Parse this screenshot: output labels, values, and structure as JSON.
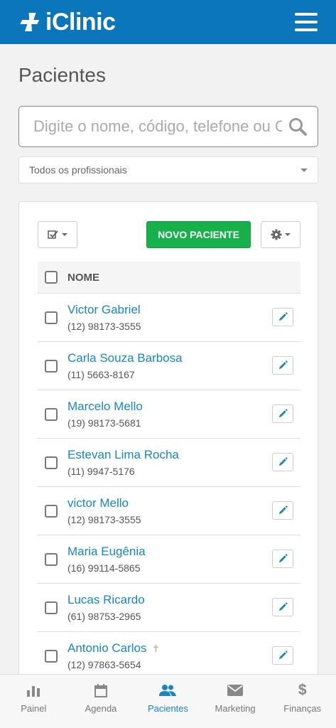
{
  "app": {
    "brand": "iClinic"
  },
  "page": {
    "title": "Pacientes"
  },
  "search": {
    "placeholder": "Digite o nome, código, telefone ou CPF"
  },
  "filter": {
    "selected": "Todos os profissionais"
  },
  "toolbar": {
    "new_patient_label": "NOVO PACIENTE"
  },
  "table": {
    "header": "NOME",
    "rows": [
      {
        "name": "Victor Gabriel",
        "phone": "(12) 98173-3555",
        "deceased": false
      },
      {
        "name": "Carla Souza Barbosa",
        "phone": "(11) 5663-8167",
        "deceased": false
      },
      {
        "name": "Marcelo Mello",
        "phone": "(19) 98173-5681",
        "deceased": false
      },
      {
        "name": "Estevan Lima Rocha",
        "phone": "(11) 9947-5176",
        "deceased": false
      },
      {
        "name": "victor Mello",
        "phone": "(12) 98173-3555",
        "deceased": false
      },
      {
        "name": "Maria Eugênia",
        "phone": "(16) 99114-5865",
        "deceased": false
      },
      {
        "name": "Lucas Ricardo",
        "phone": "(61) 98753-2965",
        "deceased": false
      },
      {
        "name": "Antonio Carlos",
        "phone": "(12) 97863-5654",
        "deceased": true
      }
    ]
  },
  "nav": {
    "tabs": [
      {
        "label": "Painel",
        "icon": "bar-chart-icon",
        "active": false
      },
      {
        "label": "Agenda",
        "icon": "calendar-icon",
        "active": false
      },
      {
        "label": "Pacientes",
        "icon": "users-icon",
        "active": true
      },
      {
        "label": "Marketing",
        "icon": "envelope-icon",
        "active": false
      },
      {
        "label": "Finanças",
        "icon": "dollar-icon",
        "active": false
      }
    ]
  },
  "colors": {
    "brand": "#0b76bb",
    "accent": "#1a85c4",
    "success": "#17b14b"
  }
}
